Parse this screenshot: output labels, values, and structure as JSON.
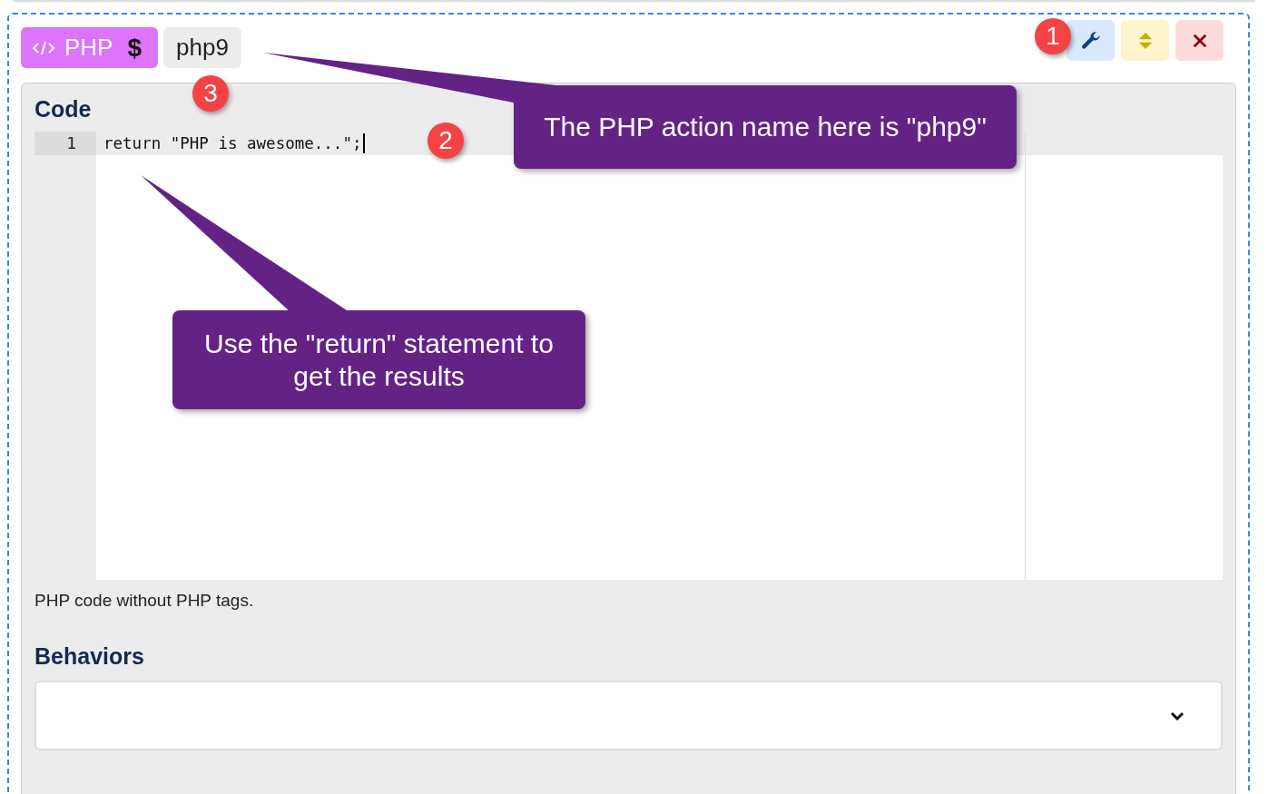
{
  "block": {
    "type_badge": {
      "label": "PHP",
      "suffix": "$"
    },
    "name_tag": "php9",
    "actions": [
      {
        "kind": "settings"
      },
      {
        "kind": "move"
      },
      {
        "kind": "delete"
      }
    ]
  },
  "code_section": {
    "label": "Code",
    "lines": [
      {
        "number": "1",
        "text": "return \"PHP is awesome...\";"
      }
    ],
    "help": "PHP code without PHP tags."
  },
  "behaviors": {
    "label": "Behaviors"
  },
  "callouts": [
    {
      "text": "The PHP action name here is \"php9\""
    },
    {
      "text": "Use the \"return\" statement to get the results"
    }
  ],
  "markers": [
    "1",
    "2",
    "3"
  ]
}
